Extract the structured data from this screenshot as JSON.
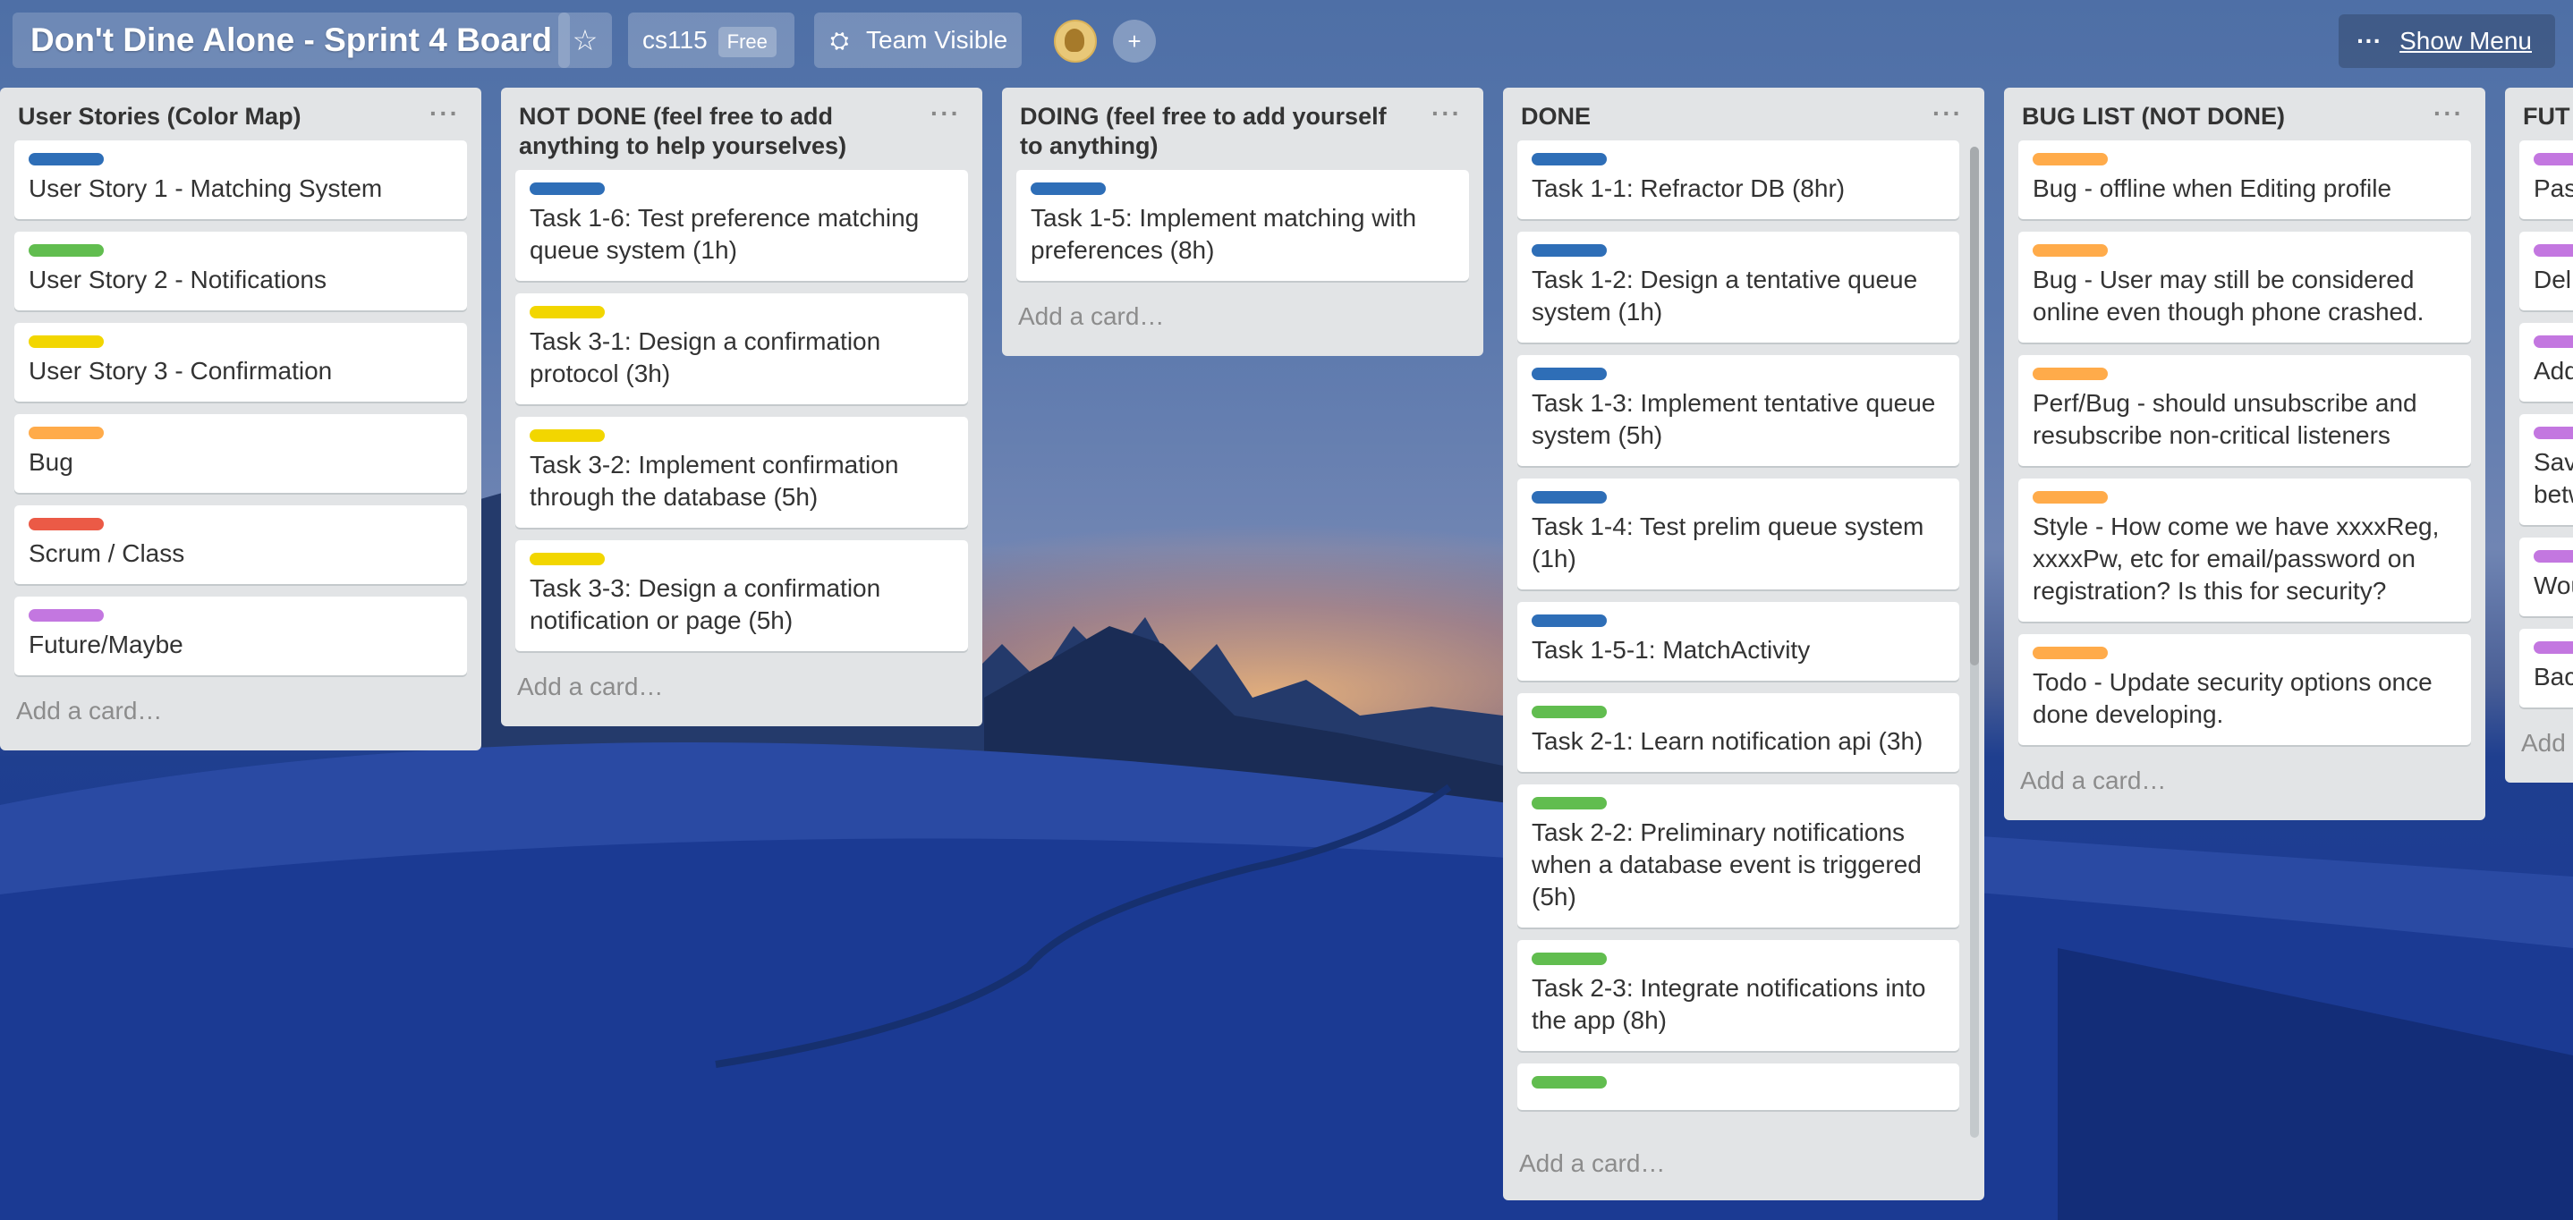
{
  "header": {
    "board_title": "Don't Dine Alone - Sprint 4 Board",
    "org_name": "cs115",
    "org_badge": "Free",
    "visibility": "Team Visible",
    "menu_dots": "···",
    "menu_label": "Show Menu"
  },
  "lists": [
    {
      "title": "User Stories (Color Map)",
      "add_card": "Add a card…",
      "cards": [
        {
          "label_color": "#2e6eb7",
          "text": "User Story 1 - Matching System"
        },
        {
          "label_color": "#61bd4f",
          "text": "User Story 2 - Notifications"
        },
        {
          "label_color": "#f2d600",
          "text": "User Story 3 - Confirmation"
        },
        {
          "label_color": "#ffab4a",
          "text": "Bug"
        },
        {
          "label_color": "#eb5a46",
          "text": "Scrum / Class"
        },
        {
          "label_color": "#c377e0",
          "text": "Future/Maybe"
        }
      ]
    },
    {
      "title": "NOT DONE (feel free to add anything to help yourselves)",
      "add_card": "Add a card…",
      "cards": [
        {
          "label_color": "#2e6eb7",
          "text": "Task 1-6: Test preference matching queue system (1h)"
        },
        {
          "label_color": "#f2d600",
          "text": "Task 3-1: Design a confirmation protocol (3h)"
        },
        {
          "label_color": "#f2d600",
          "text": "Task 3-2: Implement confirmation through the database (5h)"
        },
        {
          "label_color": "#f2d600",
          "text": "Task 3-3: Design a confirmation notification or page (5h)"
        }
      ]
    },
    {
      "title": "DOING (feel free to add yourself to anything)",
      "add_card": "Add a card…",
      "cards": [
        {
          "label_color": "#2e6eb7",
          "text": "Task 1-5: Implement matching with preferences (8h)"
        }
      ]
    },
    {
      "title": "DONE",
      "add_card": "Add a card…",
      "cards": [
        {
          "label_color": "#2e6eb7",
          "text": "Task 1-1: Refractor DB (8hr)"
        },
        {
          "label_color": "#2e6eb7",
          "text": "Task 1-2: Design a tentative queue system (1h)"
        },
        {
          "label_color": "#2e6eb7",
          "text": "Task 1-3: Implement tentative queue system (5h)"
        },
        {
          "label_color": "#2e6eb7",
          "text": "Task 1-4: Test prelim queue system (1h)"
        },
        {
          "label_color": "#2e6eb7",
          "text": "Task 1-5-1: MatchActivity"
        },
        {
          "label_color": "#61bd4f",
          "text": "Task 2-1: Learn notification api (3h)"
        },
        {
          "label_color": "#61bd4f",
          "text": "Task 2-2: Preliminary notifications when a database event is triggered (5h)"
        },
        {
          "label_color": "#61bd4f",
          "text": "Task 2-3: Integrate notifications into the app (8h)"
        },
        {
          "label_color": "#61bd4f",
          "text": ""
        }
      ]
    },
    {
      "title": "BUG LIST (NOT DONE)",
      "add_card": "Add a card…",
      "cards": [
        {
          "label_color": "#ffab4a",
          "text": "Bug - offline when Editing profile"
        },
        {
          "label_color": "#ffab4a",
          "text": "Bug - User may still be considered online even though phone crashed."
        },
        {
          "label_color": "#ffab4a",
          "text": "Perf/Bug - should unsubscribe and resubscribe non-critical listeners"
        },
        {
          "label_color": "#ffab4a",
          "text": "Style - How come we have xxxxReg, xxxxPw, etc for email/password on registration? Is this for security?"
        },
        {
          "label_color": "#ffab4a",
          "text": "Todo - Update security options once done developing."
        }
      ]
    },
    {
      "title": "FUT",
      "add_card": "Add",
      "cards": [
        {
          "label_color": "#c377e0",
          "text": "Pas"
        },
        {
          "label_color": "#c377e0",
          "text": "Del"
        },
        {
          "label_color": "#c377e0",
          "text": "Add"
        },
        {
          "label_color": "#c377e0",
          "text": "Sav betw"
        },
        {
          "label_color": "#c377e0",
          "text": "Wou"
        },
        {
          "label_color": "#c377e0",
          "text": "Bac"
        }
      ]
    }
  ]
}
